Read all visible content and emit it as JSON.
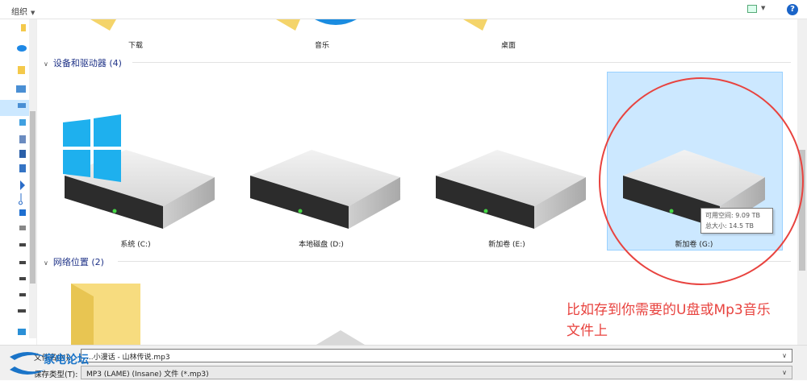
{
  "toolbar": {
    "organize_label": "组织",
    "help_label": "?"
  },
  "folders_row": [
    {
      "label": "下载"
    },
    {
      "label": "音乐"
    },
    {
      "label": "桌面"
    }
  ],
  "devices_group": {
    "title": "设备和驱动器 (4)"
  },
  "drives": [
    {
      "label": "系统 (C:)"
    },
    {
      "label": "本地磁盘 (D:)"
    },
    {
      "label": "新加卷 (E:)"
    },
    {
      "label": "新加卷 (G:)",
      "selected": true
    }
  ],
  "tooltip": {
    "line1": "可用空间: 9.09 TB",
    "line2": "总大小: 14.5 TB"
  },
  "network_group": {
    "title": "网络位置 (2)"
  },
  "annotation": {
    "line1": "比如存到你需要的U盘或Mp3音乐",
    "line2": "文件上"
  },
  "file_name": {
    "label": "文件名(N):",
    "value": "...小漫话 - 山林传说.mp3"
  },
  "file_type": {
    "label": "保存类型(T):",
    "value": "MP3 (LAME) (Insane) 文件 (*.mp3)"
  },
  "watermark": {
    "text": "家电论坛"
  },
  "colors": {
    "accent": "#e8433f",
    "selection": "#cce8ff",
    "group_header": "#1e3287"
  }
}
